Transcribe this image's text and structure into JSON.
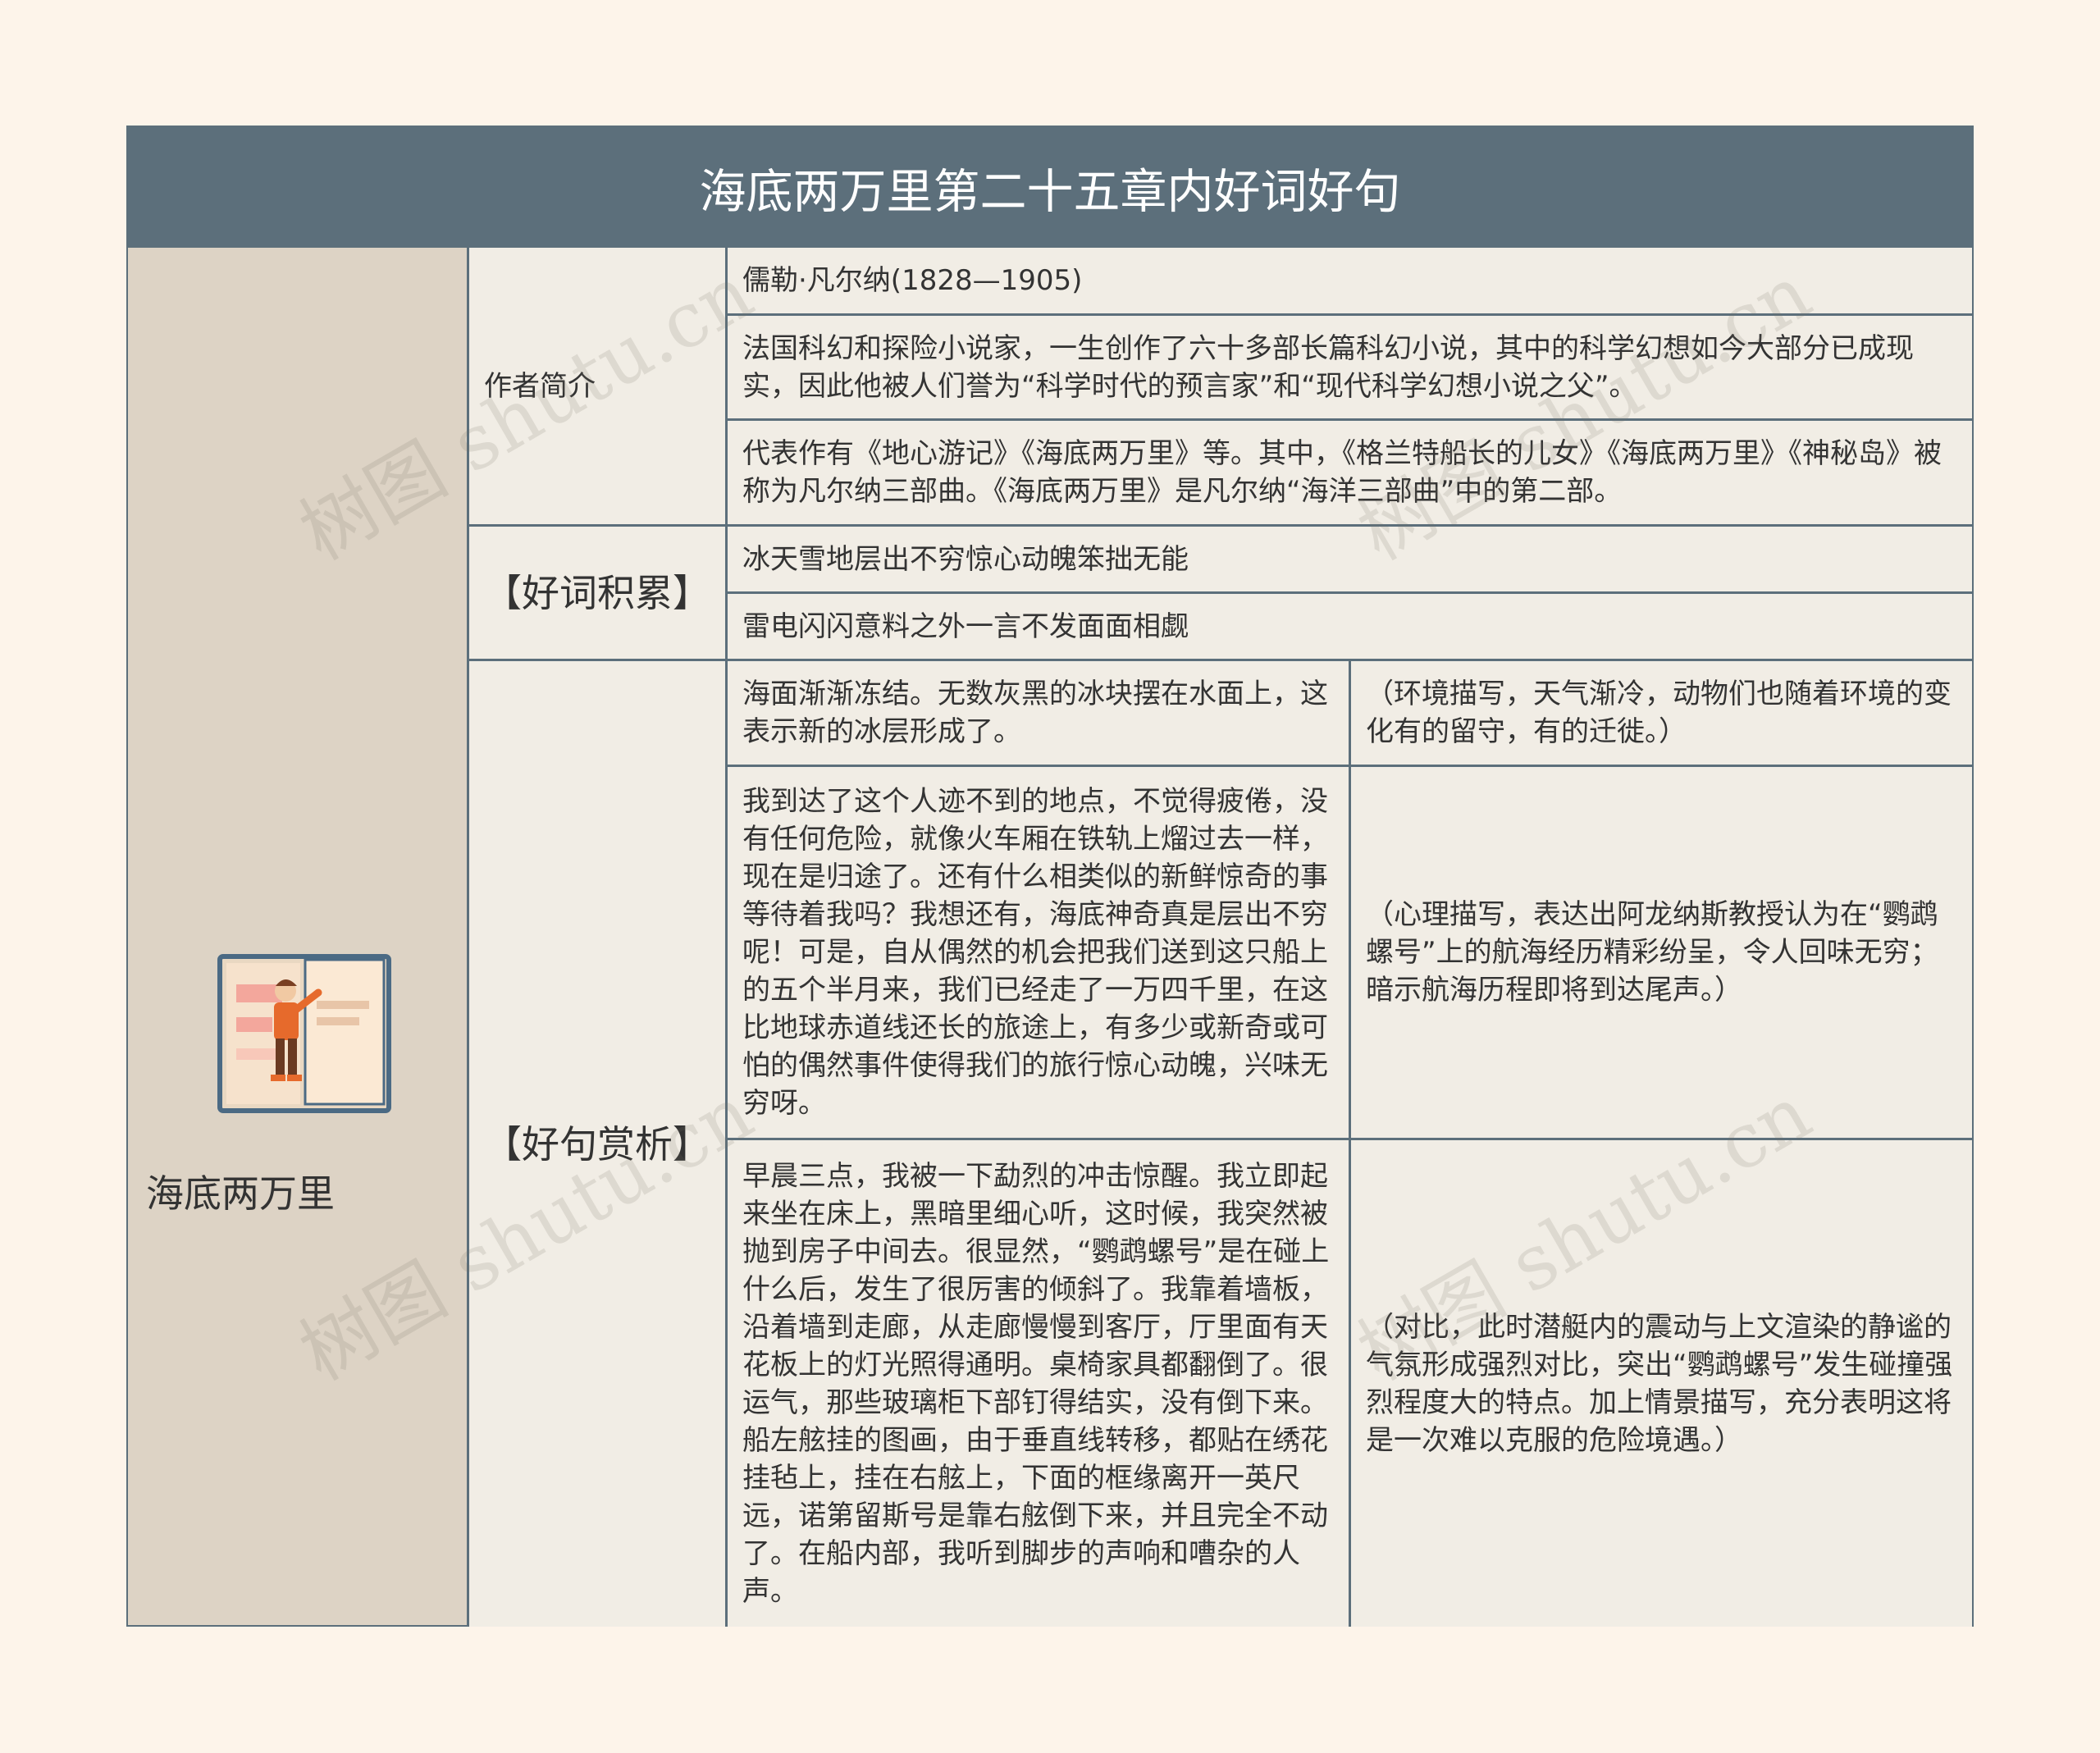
{
  "title": "海底两万里第二十五章内好词好句",
  "root": {
    "label": "海底两万里",
    "illustration": "book-reader-illustration"
  },
  "sections": {
    "author": {
      "label": "作者简介",
      "items": [
        "儒勒·凡尔纳(1828—1905)",
        "法国科幻和探险小说家，一生创作了六十多部长篇科幻小说，其中的科学幻想如今大部分已成现实，因此他被人们誉为“科学时代的预言家”和“现代科学幻想小说之父”。",
        "代表作有《地心游记》《海底两万里》等。其中，《格兰特船长的儿女》《海底两万里》《神秘岛》被称为凡尔纳三部曲。《海底两万里》是凡尔纳“海洋三部曲”中的第二部。"
      ]
    },
    "words": {
      "label": "【好词积累】",
      "items": [
        "冰天雪地层出不穷惊心动魄笨拙无能",
        "雷电闪闪意料之外一言不发面面相觑"
      ]
    },
    "sentences": {
      "label": "【好句赏析】",
      "items": [
        {
          "text": "海面渐渐冻结。无数灰黑的冰块摆在水面上，这表示新的冰层形成了。",
          "note": "（环境描写，天气渐冷，动物们也随着环境的变化有的留守，有的迁徙。）"
        },
        {
          "text": "我到达了这个人迹不到的地点，不觉得疲倦，没有任何危险，就像火车厢在铁轨上熘过去一样，现在是归途了。还有什么相类似的新鲜惊奇的事等待着我吗？我想还有，海底神奇真是层出不穷呢！可是，自从偶然的机会把我们送到这只船上的五个半月来，我们已经走了一万四千里，在这比地球赤道线还长的旅途上，有多少或新奇或可怕的偶然事件使得我们的旅行惊心动魄，兴味无穷呀。",
          "note": "（心理描写，表达出阿龙纳斯教授认为在“鹦鹉螺号”上的航海经历精彩纷呈，令人回味无穷；暗示航海历程即将到达尾声。）"
        },
        {
          "text": "早晨三点，我被一下勐烈的冲击惊醒。我立即起来坐在床上，黑暗里细心听，这时候，我突然被抛到房子中间去。很显然，“鹦鹉螺号”是在碰上什么后，发生了很厉害的倾斜了。我靠着墙板，沿着墙到走廊，从走廊慢慢到客厅，厅里面有天花板上的灯光照得通明。桌椅家具都翻倒了。很运气，那些玻璃柜下部钉得结实，没有倒下来。船左舷挂的图画，由于垂直线转移，都贴在绣花挂毡上，挂在右舷上，下面的框缘离开一英尺远，诺第留斯号是靠右舷倒下来，并且完全不动了。在船内部，我听到脚步的声响和嘈杂的人声。",
          "note": "（对比，此时潜艇内的震动与上文渲染的静谧的气氛形成强烈对比，突出“鹦鹉螺号”发生碰撞强烈程度大的特点。加上情景描写，充分表明这将是一次难以克服的危险境遇。）"
        }
      ]
    }
  },
  "watermark": "树图 shutu.cn",
  "colors": {
    "header": "#5c6f7b",
    "root_bg": "#ddd3c5",
    "cell_bg": "#f1ede5",
    "page_bg": "#fdf4ea"
  }
}
